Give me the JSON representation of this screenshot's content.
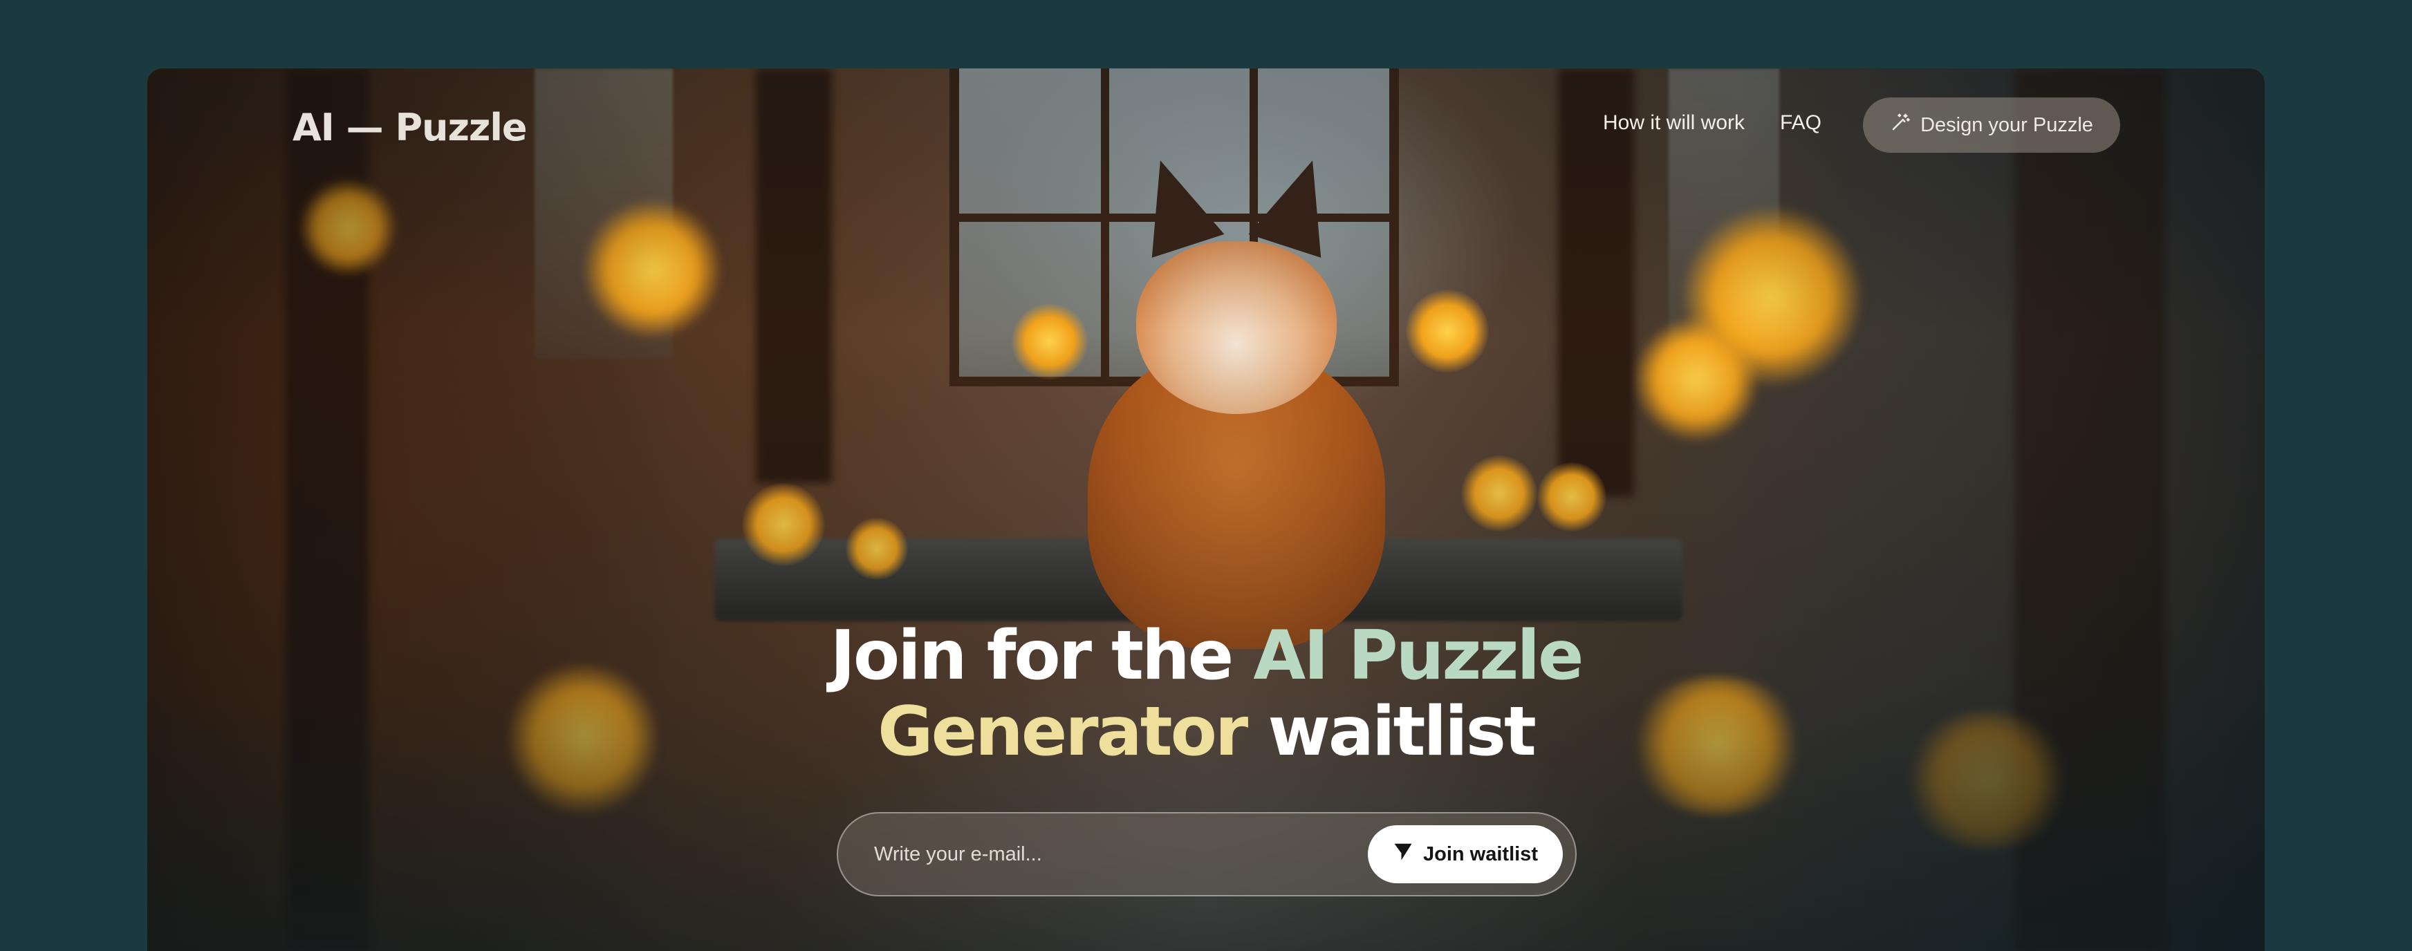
{
  "header": {
    "logo": "AI — Puzzle",
    "nav": [
      {
        "label": "How it will work"
      },
      {
        "label": "FAQ"
      }
    ],
    "cta_label": "Design your Puzzle",
    "cta_icon": "magic-wand-icon"
  },
  "hero": {
    "headline": {
      "part1": "Join for the",
      "part2": "AI Puzzle",
      "part3": "Generator",
      "part4": "waitlist"
    },
    "email_placeholder": "Write your e-mail...",
    "email_value": "",
    "join_label": "Join waitlist",
    "join_icon": "send-icon"
  },
  "colors": {
    "page_background": "#1b3a40",
    "accent_mint": "#b9d9c2",
    "accent_yellow": "#eedf9c",
    "button_white": "#ffffff"
  }
}
